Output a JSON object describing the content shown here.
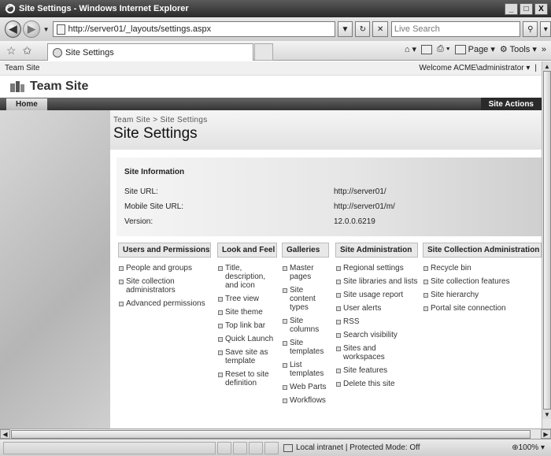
{
  "window": {
    "title": "Site Settings - Windows Internet Explorer",
    "buttons": [
      "_",
      "□",
      "X"
    ]
  },
  "address": {
    "url": "http://server01/_layouts/settings.aspx",
    "search_placeholder": "Live Search"
  },
  "tab": {
    "label": "Site Settings"
  },
  "toolbar": {
    "page_label": "Page",
    "tools_label": "Tools"
  },
  "sharepoint": {
    "top_link": "Team Site",
    "welcome": "Welcome ACME\\administrator ▾",
    "site_name": "Team Site",
    "home_tab": "Home",
    "site_actions": "Site Actions",
    "breadcrumb": "Team Site > Site Settings",
    "page_title": "Site Settings"
  },
  "site_info": {
    "heading": "Site Information",
    "rows": [
      {
        "label": "Site URL:",
        "value": "http://server01/"
      },
      {
        "label": "Mobile Site URL:",
        "value": "http://server01/m/"
      },
      {
        "label": "Version:",
        "value": "12.0.0.6219"
      }
    ]
  },
  "columns": [
    {
      "title": "Users and Permissions",
      "items": [
        "People and groups",
        "Site collection administrators",
        "Advanced permissions"
      ]
    },
    {
      "title": "Look and Feel",
      "items": [
        "Title, description, and icon",
        "Tree view",
        "Site theme",
        "Top link bar",
        "Quick Launch",
        "Save site as template",
        "Reset to site definition"
      ]
    },
    {
      "title": "Galleries",
      "items": [
        "Master pages",
        "Site content types",
        "Site columns",
        "Site templates",
        "List templates",
        "Web Parts",
        "Workflows"
      ]
    },
    {
      "title": "Site Administration",
      "items": [
        "Regional settings",
        "Site libraries and lists",
        "Site usage report",
        "User alerts",
        "RSS",
        "Search visibility",
        "Sites and workspaces",
        "Site features",
        "Delete this site"
      ]
    },
    {
      "title": "Site Collection Administration",
      "items": [
        "Recycle bin",
        "Site collection features",
        "Site hierarchy",
        "Portal site connection"
      ]
    }
  ],
  "status": {
    "zone": "Local intranet | Protected Mode: Off",
    "zoom": "100%"
  }
}
